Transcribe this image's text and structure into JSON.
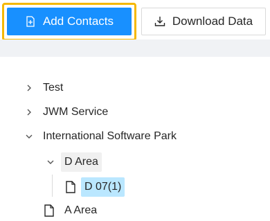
{
  "toolbar": {
    "add_contacts_label": "Add Contacts",
    "download_data_label": "Download Data",
    "add_icon": "file-plus-icon",
    "download_icon": "download-icon",
    "primary_color": "#1890ff",
    "highlight_color": "#f5b800"
  },
  "tree": {
    "items": [
      {
        "label": "Test",
        "expanded": false,
        "switcher_icon": "chevron-right-icon"
      },
      {
        "label": "JWM Service",
        "expanded": false,
        "switcher_icon": "chevron-right-icon"
      },
      {
        "label": "International Software Park",
        "expanded": true,
        "switcher_icon": "chevron-down-icon"
      },
      {
        "label": "D Area",
        "expanded": true,
        "switcher_icon": "chevron-down-icon"
      },
      {
        "label": "D 07(1)",
        "selected": true,
        "icon": "file-icon"
      },
      {
        "label": "A Area",
        "icon": "file-icon"
      }
    ],
    "selected_color": "#bae7ff"
  }
}
